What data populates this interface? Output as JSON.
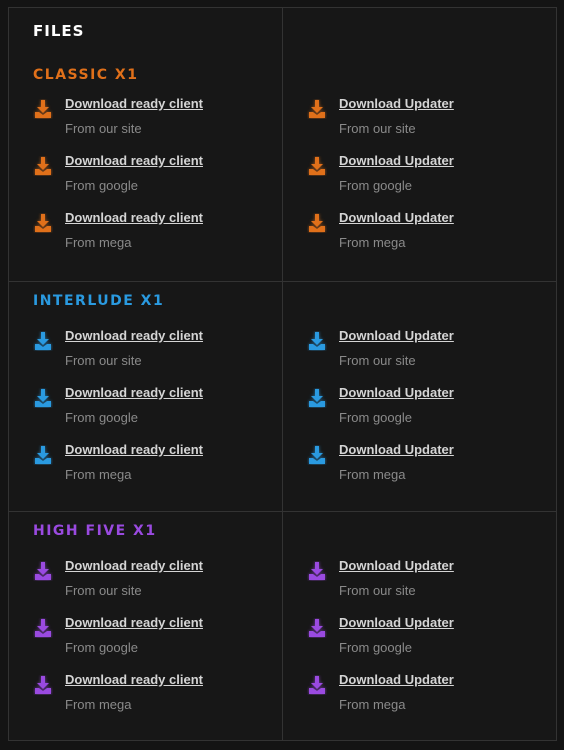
{
  "title": "FILES",
  "sections": [
    {
      "name": "CLASSIC X1",
      "color": "#e0701a",
      "client": [
        {
          "link": "Download ready client",
          "source": "From our site"
        },
        {
          "link": "Download ready client",
          "source": "From google"
        },
        {
          "link": "Download ready client",
          "source": "From mega"
        }
      ],
      "updater": [
        {
          "link": "Download Updater",
          "source": "From our site"
        },
        {
          "link": "Download Updater",
          "source": "From google"
        },
        {
          "link": "Download Updater",
          "source": "From mega"
        }
      ]
    },
    {
      "name": "INTERLUDE X1",
      "color": "#2a9ae0",
      "client": [
        {
          "link": "Download ready client",
          "source": "From our site"
        },
        {
          "link": "Download ready client",
          "source": "From google"
        },
        {
          "link": "Download ready client",
          "source": "From mega"
        }
      ],
      "updater": [
        {
          "link": "Download Updater",
          "source": "From our site"
        },
        {
          "link": "Download Updater",
          "source": "From google"
        },
        {
          "link": "Download Updater",
          "source": "From mega"
        }
      ]
    },
    {
      "name": "HIGH FIVE X1",
      "color": "#9a4ae0",
      "client": [
        {
          "link": "Download ready client",
          "source": "From our site"
        },
        {
          "link": "Download ready client",
          "source": "From google"
        },
        {
          "link": "Download ready client",
          "source": "From mega"
        }
      ],
      "updater": [
        {
          "link": "Download Updater",
          "source": "From our site"
        },
        {
          "link": "Download Updater",
          "source": "From google"
        },
        {
          "link": "Download Updater",
          "source": "From mega"
        }
      ]
    }
  ],
  "icons": {
    "download": "download-icon"
  }
}
